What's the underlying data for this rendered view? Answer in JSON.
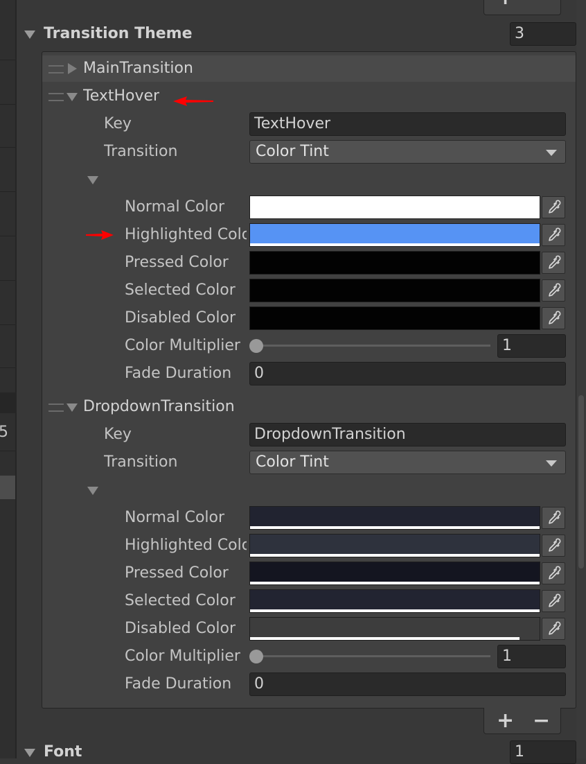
{
  "transition_theme": {
    "title": "Transition Theme",
    "count": "3",
    "items": [
      {
        "name": "MainTransition"
      },
      {
        "name": "TextHover",
        "key_label": "Key",
        "key_value": "TextHover",
        "transition_label": "Transition",
        "transition_value": "Color Tint",
        "colors": [
          {
            "label": "Normal Color",
            "hex": "#ffffff",
            "alpha": 1.0
          },
          {
            "label": "Highlighted Color",
            "hex": "#5693f4",
            "alpha": 1.0
          },
          {
            "label": "Pressed Color",
            "hex": "#020202",
            "alpha": 0.0
          },
          {
            "label": "Selected Color",
            "hex": "#020202",
            "alpha": 0.0
          },
          {
            "label": "Disabled Color",
            "hex": "#020202",
            "alpha": 0.0
          }
        ],
        "multiplier_label": "Color Multiplier",
        "multiplier_value": "1",
        "multiplier_fraction": 0.0,
        "fade_label": "Fade Duration",
        "fade_value": "0"
      },
      {
        "name": "DropdownTransition",
        "key_label": "Key",
        "key_value": "DropdownTransition",
        "transition_label": "Transition",
        "transition_value": "Color Tint",
        "colors": [
          {
            "label": "Normal Color",
            "hex": "#212330",
            "alpha": 1.0
          },
          {
            "label": "Highlighted Color",
            "hex": "#2e323d",
            "alpha": 1.0
          },
          {
            "label": "Pressed Color",
            "hex": "#141520",
            "alpha": 1.0
          },
          {
            "label": "Selected Color",
            "hex": "#222431",
            "alpha": 1.0
          },
          {
            "label": "Disabled Color",
            "hex": "#3d3d3d",
            "alpha": 0.93
          }
        ],
        "multiplier_label": "Color Multiplier",
        "multiplier_value": "1",
        "multiplier_fraction": 0.0,
        "fade_label": "Fade Duration",
        "fade_value": "0"
      }
    ],
    "add_symbol": "+",
    "remove_symbol": "−"
  },
  "font": {
    "title": "Font",
    "count": "1"
  },
  "left_partial_value": "5",
  "annotation_color": "#ff0000",
  "icons": {
    "picker": "eyedropper-icon",
    "expand": "triangle-down-icon",
    "collapsed": "triangle-right-icon",
    "drag": "drag-handle-icon"
  }
}
